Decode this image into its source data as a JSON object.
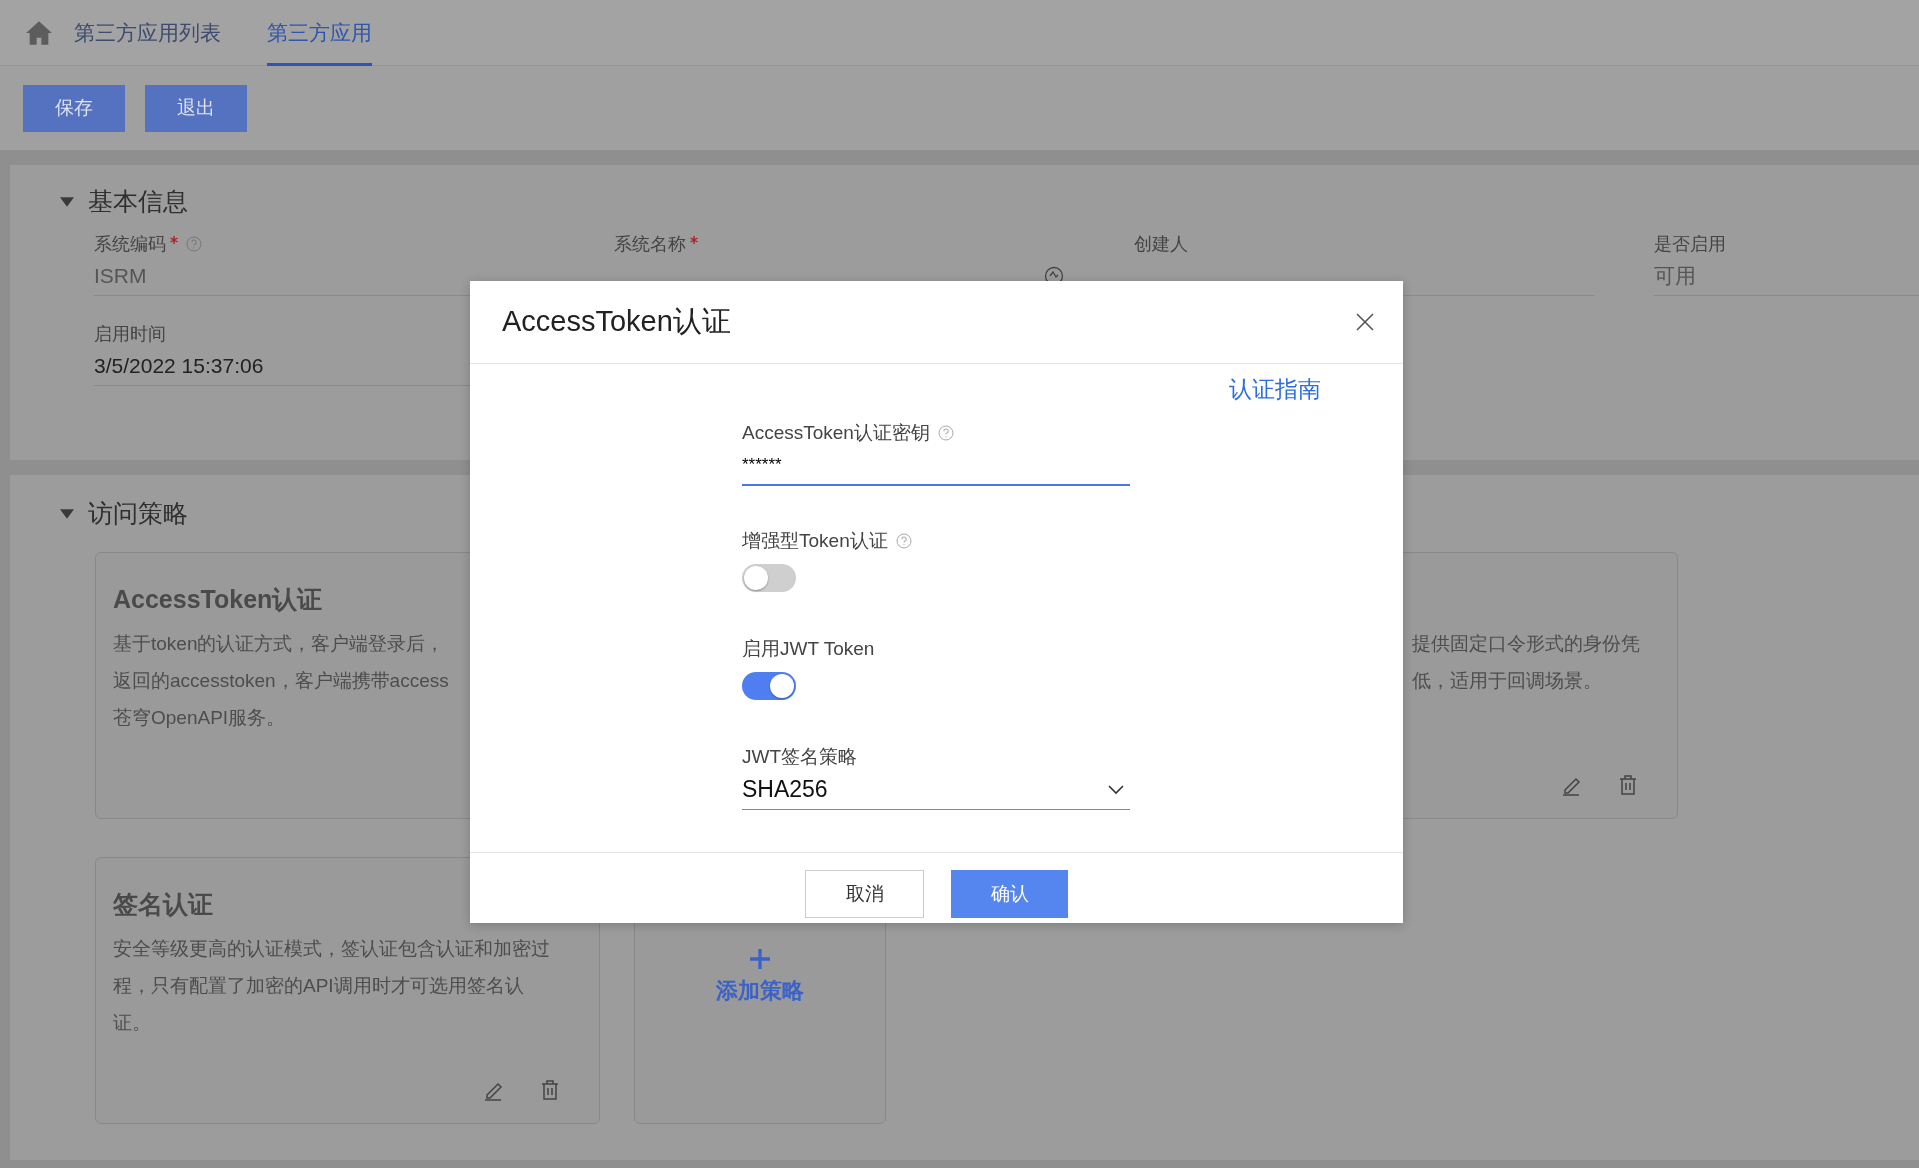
{
  "breadcrumb": {
    "tabs": [
      {
        "label": "第三方应用列表",
        "selected": false
      },
      {
        "label": "第三方应用",
        "selected": true
      }
    ]
  },
  "toolbar": {
    "buttons": [
      "保存",
      "退出"
    ]
  },
  "basic_info": {
    "title": "基本信息",
    "expanded": true,
    "fields": [
      {
        "kind": "text",
        "label": "系统编码",
        "required": true,
        "help": true,
        "value": "ISRM",
        "disabled": true
      },
      {
        "kind": "multilang",
        "label": "系统名称",
        "required": true,
        "help": false
      },
      {
        "kind": "text",
        "label": "创建人",
        "required": false,
        "help": false
      },
      {
        "kind": "text",
        "label": "是否启用",
        "required": false,
        "help": false,
        "value": "可用",
        "disabled": true
      },
      {
        "kind": "date",
        "label": "启用时间",
        "required": false,
        "help": false,
        "value": "3/5/2022 15:37:06",
        "disabled": false
      }
    ]
  },
  "access_policy": {
    "title": "访问策略",
    "expanded": true,
    "cards": [
      {
        "kind": "policy",
        "title": "AccessToken认证",
        "lines": [
          "基于token的认证方式，客户端登录后，",
          "返回的accesstoken，客户端携带access",
          "苍穹OpenAPI服务。"
        ]
      },
      {
        "kind": "policy",
        "lines": [
          "提供固定口令形式的身份凭",
          "低，适用于回调场景。"
        ],
        "actions": true
      },
      {
        "kind": "policy",
        "title": "签名认证",
        "lines": [
          "安全等级更高的认证模式，签认证包含认证和加密过",
          "程，只有配置了加密的API调用时才可选用签名认",
          "证。"
        ],
        "actions": true
      },
      {
        "kind": "add",
        "label": "添加策略"
      }
    ]
  },
  "dialog": {
    "title": "AccessToken认证",
    "guide_link": "认证指南",
    "fields": [
      {
        "kind": "password",
        "label": "AccessToken认证密钥",
        "help": true,
        "value": "******",
        "focused": true
      },
      {
        "kind": "switch",
        "label": "增强型Token认证",
        "help": true,
        "on": false
      },
      {
        "kind": "switch",
        "label": "启用JWT Token",
        "help": false,
        "on": true
      },
      {
        "kind": "select",
        "label": "JWT签名策略",
        "help": false,
        "value": "SHA256",
        "focused": false
      }
    ],
    "buttons": [
      {
        "label": "取消",
        "primary": false
      },
      {
        "label": "确认",
        "primary": true
      }
    ]
  }
}
